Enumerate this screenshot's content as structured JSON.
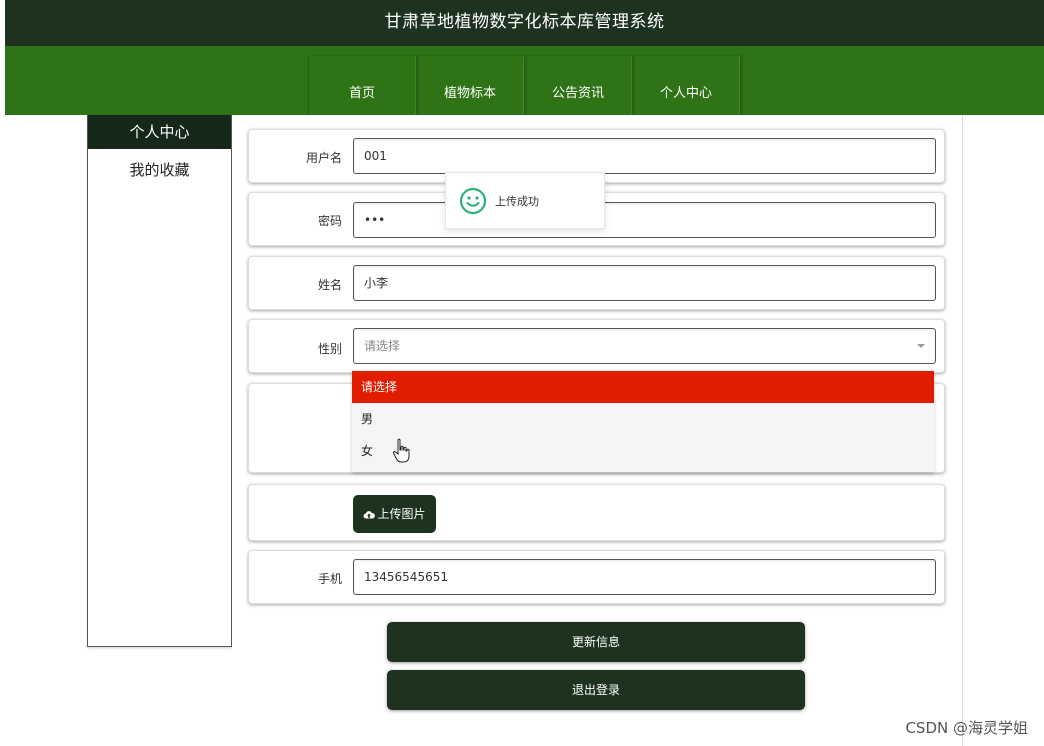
{
  "app": {
    "title": "甘肃草地植物数字化标本库管理系统"
  },
  "nav": {
    "items": [
      "首页",
      "植物标本",
      "公告资讯",
      "个人中心"
    ]
  },
  "sidebar": {
    "items": [
      {
        "label": "个人中心",
        "active": true
      },
      {
        "label": "我的收藏",
        "active": false
      }
    ]
  },
  "form": {
    "username": {
      "label": "用户名",
      "value": "001"
    },
    "password": {
      "label": "密码",
      "value": "•••"
    },
    "name": {
      "label": "姓名",
      "value": "小李"
    },
    "gender": {
      "label": "性别",
      "placeholder": "请选择",
      "options": [
        "请选择",
        "男",
        "女"
      ],
      "highlighted": "请选择"
    },
    "upload": {
      "label": "上传图片"
    },
    "phone": {
      "label": "手机",
      "value": "13456545651"
    }
  },
  "actions": {
    "update": "更新信息",
    "logout": "退出登录"
  },
  "toast": {
    "message": "上传成功",
    "icon": "smile-icon"
  },
  "watermark": "CSDN @海灵学姐",
  "colors": {
    "header": "#1e3220",
    "nav": "#2e7416",
    "highlight": "#e01d00",
    "button": "#1e3220"
  }
}
